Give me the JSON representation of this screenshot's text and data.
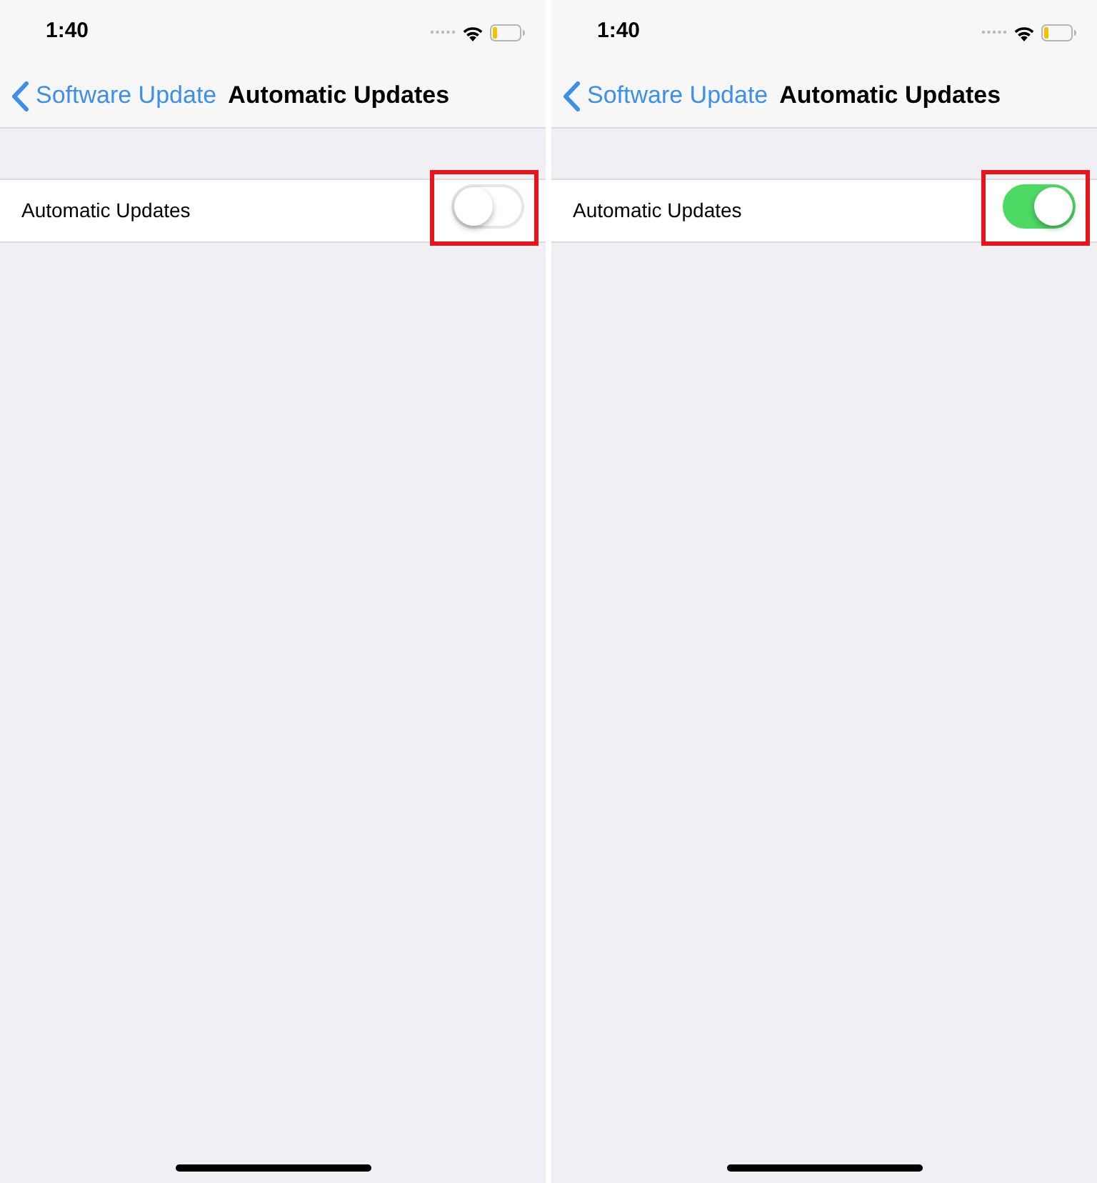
{
  "screens": [
    {
      "status_bar": {
        "time": "1:40"
      },
      "nav_bar": {
        "back_label": "Software Update",
        "title": "Automatic Updates"
      },
      "settings": [
        {
          "kind": "toggle",
          "label": "Automatic Updates",
          "on": false,
          "highlighted": true
        }
      ]
    },
    {
      "status_bar": {
        "time": "1:40"
      },
      "nav_bar": {
        "back_label": "Software Update",
        "title": "Automatic Updates"
      },
      "settings": [
        {
          "kind": "toggle",
          "label": "Automatic Updates",
          "on": true,
          "highlighted": true
        }
      ]
    }
  ]
}
